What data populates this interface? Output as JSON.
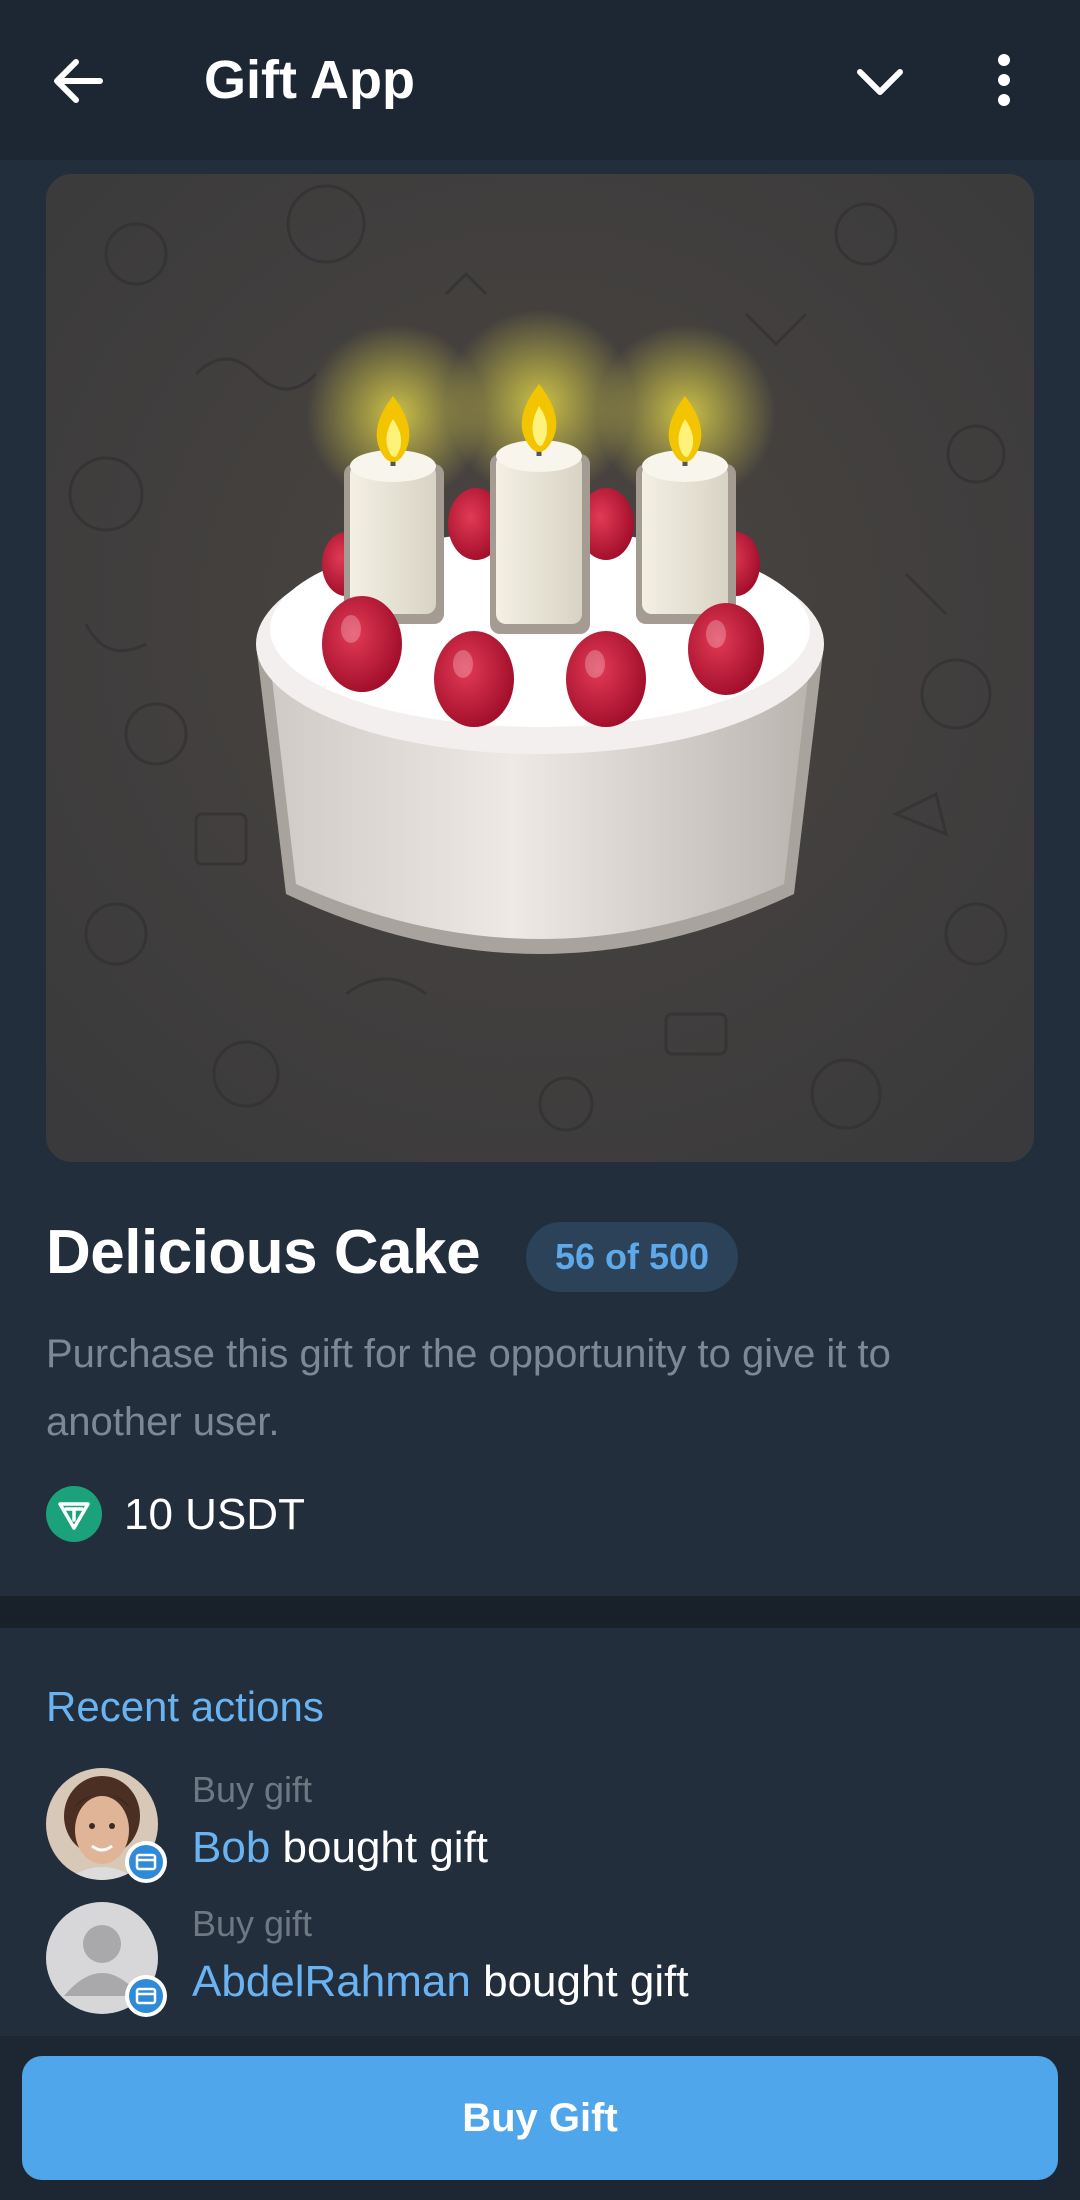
{
  "header": {
    "title": "Gift App",
    "back_icon": "arrow-left-icon",
    "dropdown_icon": "chevron-down-icon",
    "more_icon": "more-vertical-icon"
  },
  "gift": {
    "image": "birthday-cake-with-candles",
    "name": "Delicious Cake",
    "availability": "56 of 500",
    "description": "Purchase this gift for the opportunity to give it to another user.",
    "price": "10 USDT",
    "price_icon": "usdt-tether-icon"
  },
  "recent_actions": {
    "title": "Recent actions",
    "items": [
      {
        "type": "Buy gift",
        "user": "Bob",
        "text": "bought gift",
        "avatar": "photo-avatar"
      },
      {
        "type": "Buy gift",
        "user": "AbdelRahman",
        "text": "bought gift",
        "avatar": "default-avatar"
      }
    ]
  },
  "footer": {
    "buy_label": "Buy Gift"
  },
  "colors": {
    "background": "#232e3c",
    "header": "#1d2733",
    "accent": "#50a6ea",
    "link": "#6ab3f3",
    "badge_bg": "#2b4259",
    "usdt": "#1ba27a"
  }
}
